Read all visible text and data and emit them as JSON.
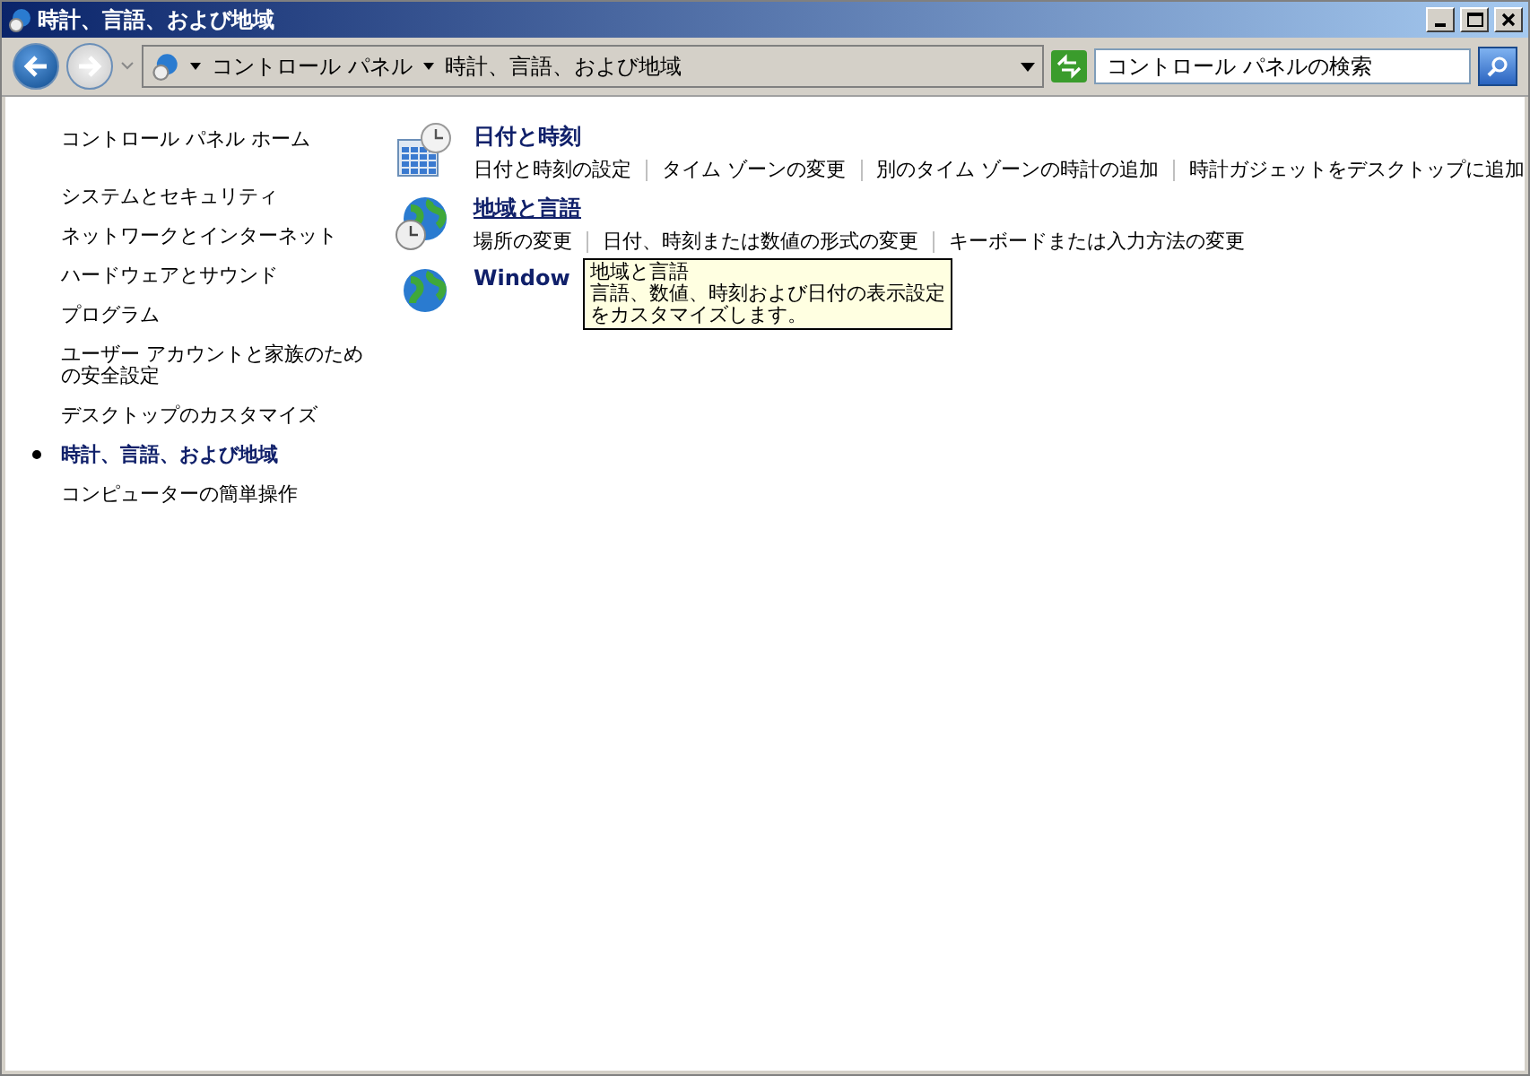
{
  "window": {
    "title": "時計、言語、および地域"
  },
  "address_bar": {
    "breadcrumbs": [
      "コントロール パネル",
      "時計、言語、および地域"
    ]
  },
  "search": {
    "placeholder": "コントロール パネルの検索"
  },
  "sidebar": {
    "items": [
      {
        "label": "コントロール パネル ホーム",
        "kind": "home",
        "selected": false
      },
      {
        "label": "システムとセキュリティ",
        "kind": "category",
        "selected": false
      },
      {
        "label": "ネットワークとインターネット",
        "kind": "category",
        "selected": false
      },
      {
        "label": "ハードウェアとサウンド",
        "kind": "category",
        "selected": false
      },
      {
        "label": "プログラム",
        "kind": "category",
        "selected": false
      },
      {
        "label": "ユーザー アカウントと家族のための安全設定",
        "kind": "category",
        "selected": false
      },
      {
        "label": "デスクトップのカスタマイズ",
        "kind": "category",
        "selected": false
      },
      {
        "label": "時計、言語、および地域",
        "kind": "category",
        "selected": true
      },
      {
        "label": "コンピューターの簡単操作",
        "kind": "category",
        "selected": false
      }
    ]
  },
  "categories": [
    {
      "title": "日付と時刻",
      "kind": "calendar",
      "hovered": false,
      "links": [
        "日付と時刻の設定",
        "タイム ゾーンの変更",
        "別のタイム ゾーンの時計の追加",
        "時計ガジェットをデスクトップに追加"
      ]
    },
    {
      "title": "地域と言語",
      "kind": "globe-clock",
      "hovered": true,
      "links": [
        "場所の変更",
        "日付、時刻または数値の形式の変更",
        "キーボードまたは入力方法の変更"
      ]
    },
    {
      "title": "Window",
      "kind": "globe",
      "hovered": false
    }
  ],
  "tooltip": {
    "title": "地域と言語",
    "lines": [
      "言語、数値、時刻および日付の表示設定",
      "をカスタマイズします。"
    ]
  }
}
